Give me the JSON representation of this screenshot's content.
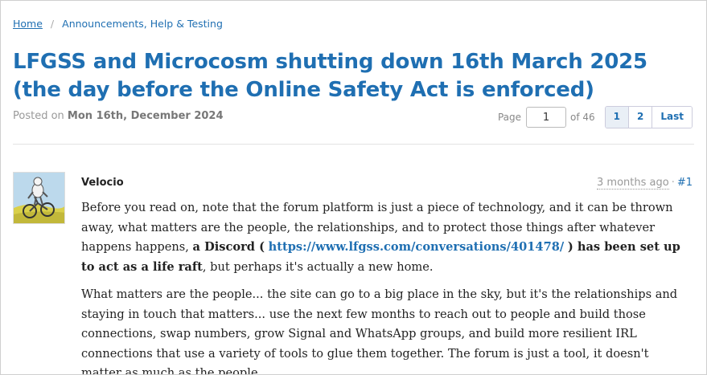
{
  "breadcrumb": {
    "home": "Home",
    "separator": "/",
    "section": "Announcements, Help & Testing"
  },
  "thread": {
    "title": "LFGSS and Microcosm shutting down 16th March 2025 (the day before the Online Safety Act is enforced)",
    "posted_label": "Posted on",
    "posted_date": "Mon 16th, December 2024"
  },
  "pagination": {
    "page_label": "Page",
    "current_page": "1",
    "of_label": "of 46",
    "buttons": [
      "1",
      "2",
      "Last"
    ]
  },
  "post": {
    "author": "Velocio",
    "time_ago": "3 months ago",
    "meta_separator": "·",
    "post_number": "#1",
    "avatar_icon": "cyclist-avatar-icon",
    "p1_part1": "Before you read on, note that the forum platform is just a piece of technology, and it can be thrown away, what matters are the people, the relationships, and to protect those things after whatever happens happens,",
    "p1_bold1": "a Discord (",
    "p1_link": "https://www.lfgss.com/conversations/401478/",
    "p1_bold2": ") has been set up to act as a life raft",
    "p1_part2": ", but perhaps it's actually a new home.",
    "p2": "What matters are the people... the site can go to a big place in the sky, but it's the relationships and staying in touch that matters... use the next few months to reach out to people and build those connections, swap numbers, grow Signal and WhatsApp groups, and build more resilient IRL connections that use a variety of tools to glue them together. The forum is just a tool, it doesn't matter as much as the people."
  },
  "colors": {
    "link": "#1f6fb2",
    "text": "#222222",
    "muted": "#999999"
  }
}
